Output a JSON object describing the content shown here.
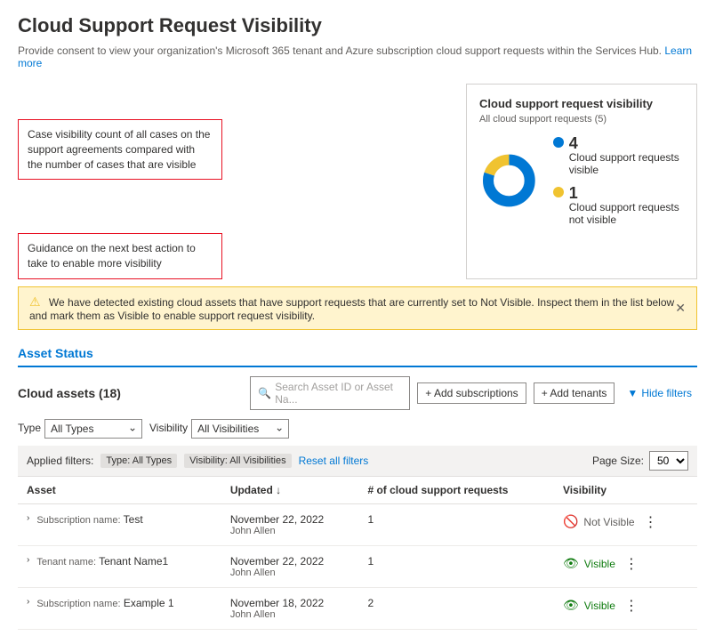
{
  "page": {
    "title": "Cloud Support Request Visibility",
    "subtitle": "Provide consent to view your organization's Microsoft 365 tenant and Azure subscription cloud support requests within the Services Hub.",
    "learn_more": "Learn more"
  },
  "annotations": {
    "callout1": "Case visibility count of all cases on the support agreements compared with the number of cases that are visible",
    "callout2": "Guidance on the next best action to take to enable more visibility"
  },
  "chart": {
    "title": "Cloud support request visibility",
    "subtitle": "All cloud support requests (5)",
    "visible_count": "4",
    "visible_label": "Cloud support requests visible",
    "not_visible_count": "1",
    "not_visible_label": "Cloud support requests not visible",
    "color_visible": "#0078d4",
    "color_not_visible": "#f0c330"
  },
  "warning": {
    "message": "We have detected existing cloud assets that have support requests that are currently set to Not Visible. Inspect them in the list below and mark them as Visible to enable support request visibility."
  },
  "asset_status": {
    "tab_label": "Asset Status",
    "cloud_assets_title": "Cloud assets (18)",
    "search_placeholder": "Search Asset ID or Asset Na...",
    "add_subscriptions_btn": "+ Add subscriptions",
    "add_tenants_btn": "+ Add tenants",
    "hide_filters_btn": "Hide filters",
    "filters": {
      "type_label": "Type",
      "type_default": "All Types",
      "visibility_label": "Visibility",
      "visibility_default": "All Visibilities"
    },
    "applied_filters": {
      "label": "Applied filters:",
      "tags": [
        "Type: All Types",
        "Visibility: All Visibilities"
      ],
      "reset_label": "Reset all filters"
    },
    "page_size_label": "Page Size:",
    "page_size_value": "50",
    "columns": {
      "asset": "Asset",
      "updated": "Updated ↓",
      "requests": "# of cloud support requests",
      "visibility": "Visibility"
    },
    "rows": [
      {
        "type_label": "Subscription name:",
        "type_value": "Test",
        "updated_date": "November 22, 2022",
        "updated_user": "John Allen",
        "requests": "1",
        "visibility_type": "not-visible",
        "visibility_label": "Not Visible"
      },
      {
        "type_label": "Tenant name:",
        "type_value": "Tenant Name1",
        "updated_date": "November 22, 2022",
        "updated_user": "John Allen",
        "requests": "1",
        "visibility_type": "visible",
        "visibility_label": "Visible"
      },
      {
        "type_label": "Subscription name:",
        "type_value": "Example 1",
        "updated_date": "November 18, 2022",
        "updated_user": "John Allen",
        "requests": "2",
        "visibility_type": "visible",
        "visibility_label": "Visible"
      }
    ]
  }
}
